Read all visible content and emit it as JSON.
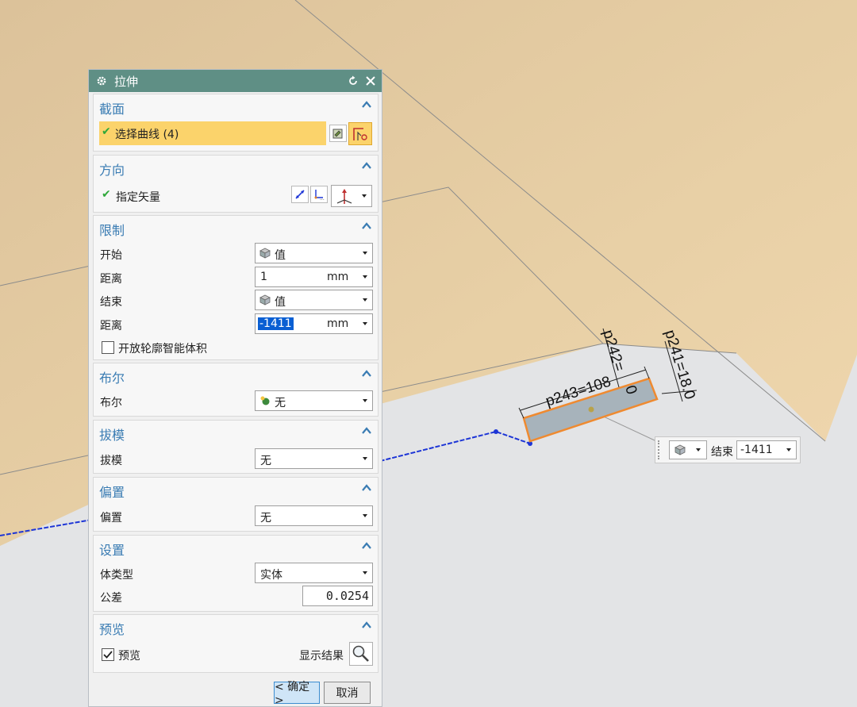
{
  "dialog": {
    "title": "拉伸",
    "sections": {
      "section": {
        "title": "截面",
        "select_curve_label": "选择曲线 (4)"
      },
      "direction": {
        "title": "方向",
        "specify_vector_label": "指定矢量"
      },
      "limits": {
        "title": "限制",
        "start_label": "开始",
        "start_value": "值",
        "distance1_label": "距离",
        "distance1_value": "1",
        "distance1_unit": "mm",
        "end_label": "结束",
        "end_value": "值",
        "distance2_label": "距离",
        "distance2_value": "-1411",
        "distance2_unit": "mm",
        "open_profile_label": "开放轮廓智能体积"
      },
      "boolean": {
        "title": "布尔",
        "label": "布尔",
        "value": "无"
      },
      "draft": {
        "title": "拔模",
        "label": "拔模",
        "value": "无"
      },
      "offset": {
        "title": "偏置",
        "label": "偏置",
        "value": "无"
      },
      "settings": {
        "title": "设置",
        "body_type_label": "体类型",
        "body_type_value": "实体",
        "tolerance_label": "公差",
        "tolerance_value": "0.0254"
      },
      "preview": {
        "title": "预览",
        "preview_label": "预览",
        "preview_checked": true,
        "show_result_label": "显示结果"
      }
    },
    "footer": {
      "ok_label": "< 确定 >",
      "cancel_label": "取消"
    }
  },
  "canvas": {
    "dimensions": {
      "p243": "p243=108",
      "p242": "p242=",
      "p242_val": "0",
      "p241": "p241=18.0"
    },
    "float_widget": {
      "end_label": "结束",
      "end_value": "-1411"
    }
  },
  "colors": {
    "background_sheet": "#e6cfa6",
    "canvas_grey": "#e3e4e6",
    "titlebar": "#5f8f85",
    "highlight": "#fbd36b",
    "group_title": "#3a7cb3",
    "selection": "#0a5fd3",
    "shape_fill": "#a7b3bb",
    "shape_outline": "#ef8a30",
    "curve": "#1d35d6"
  }
}
